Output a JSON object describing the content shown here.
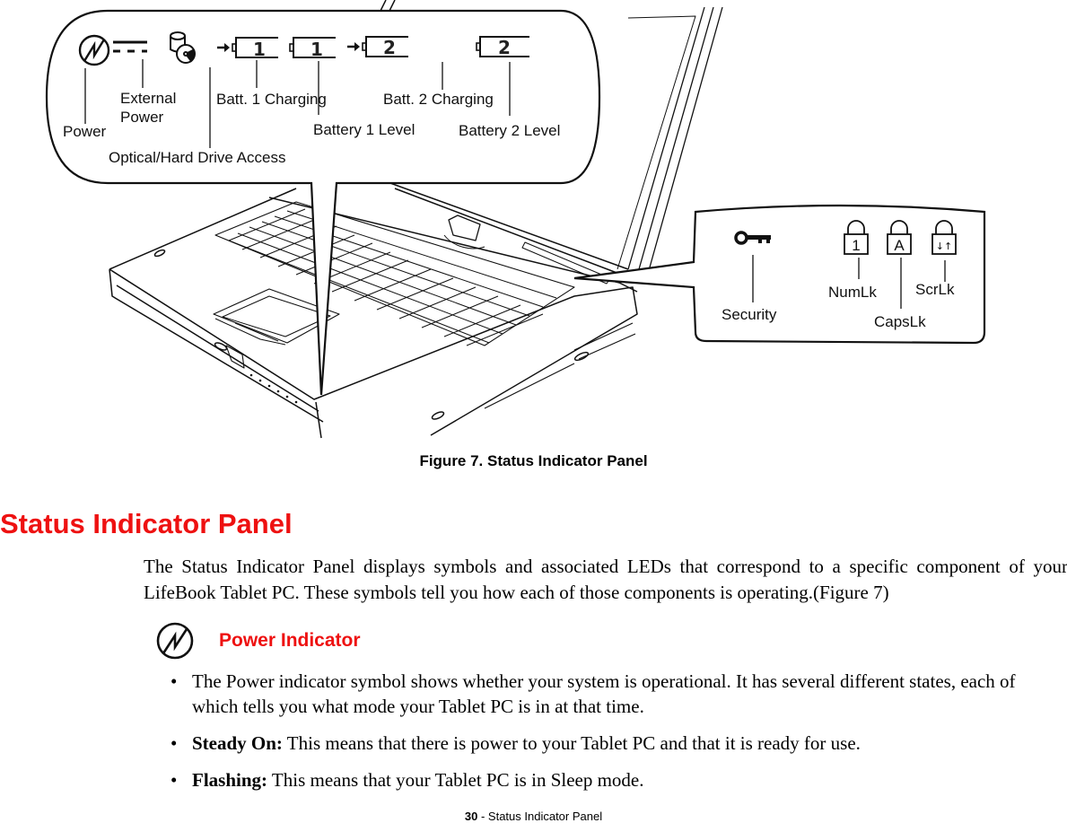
{
  "figure": {
    "top_callout": {
      "labels": {
        "power": "Power",
        "external_power_line1": "External",
        "external_power_line2": "Power",
        "drive_access": "Optical/Hard Drive Access",
        "batt1_charging": "Batt. 1 Charging",
        "battery1_level": "Battery 1 Level",
        "batt2_charging": "Batt. 2 Charging",
        "battery2_level": "Battery 2 Level"
      },
      "battery_glyphs": [
        "1",
        "1",
        "2",
        "2"
      ]
    },
    "side_callout": {
      "labels": {
        "security": "Security",
        "numlk": "NumLk",
        "capslk": "CapsLk",
        "scrlk": "ScrLk"
      },
      "lock_glyphs": [
        "1",
        "A",
        "↓↑"
      ]
    },
    "caption": "Figure 7.  Status Indicator Panel"
  },
  "section": {
    "title": "Status Indicator Panel",
    "intro": "The Status Indicator Panel displays symbols and associated LEDs that correspond to a specific component of your LifeBook Tablet PC. These symbols tell you how each of those components is operating.(Figure 7)"
  },
  "power_indicator": {
    "title": "Power Indicator",
    "icon": "power-icon",
    "bullets": [
      {
        "bold": "",
        "text": "The Power indicator symbol shows whether your system is operational. It has several different states, each of which tells you what mode your Tablet PC is in at that time."
      },
      {
        "bold": "Steady On:",
        "text": " This means that there is power to your Tablet PC and that it is ready for use."
      },
      {
        "bold": "Flashing:",
        "text": " This means that your Tablet PC is in Sleep mode."
      }
    ],
    "bullet_char": "•"
  },
  "footer": {
    "page_number": "30",
    "separator": " - ",
    "section_name": "Status Indicator Panel"
  },
  "colors": {
    "heading_red": "#ee1111",
    "text": "#000000"
  }
}
